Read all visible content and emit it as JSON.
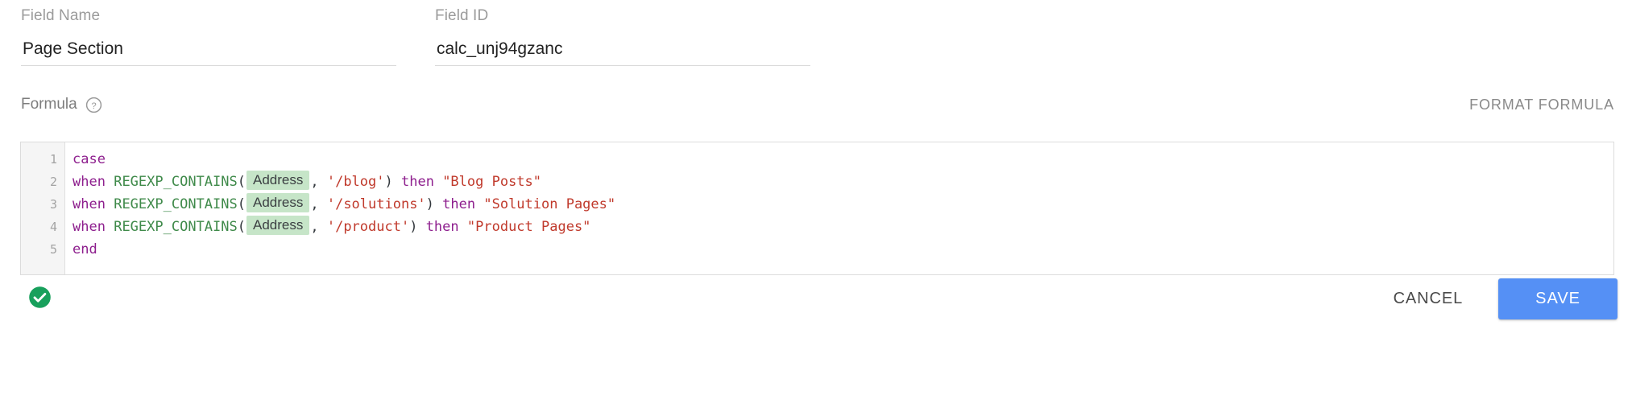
{
  "fields": [
    {
      "label": "Field Name",
      "value": "Page Section",
      "name": "field-name"
    },
    {
      "label": "Field ID",
      "value": "calc_unj94gzanc",
      "name": "field-id"
    }
  ],
  "formula": {
    "label": "Formula",
    "help_icon": "help-circle-icon",
    "format_button": "FORMAT FORMULA",
    "line_numbers": [
      "1",
      "2",
      "3",
      "4",
      "5"
    ],
    "lines": [
      {
        "n": "1",
        "tokens": [
          {
            "t": "keyword",
            "v": "case"
          }
        ]
      },
      {
        "n": "2",
        "tokens": [
          {
            "t": "keyword",
            "v": "when"
          },
          {
            "t": "plain",
            "v": " "
          },
          {
            "t": "function",
            "v": "REGEXP_CONTAINS"
          },
          {
            "t": "punct",
            "v": "("
          },
          {
            "t": "pill",
            "v": "Address"
          },
          {
            "t": "punct",
            "v": ", "
          },
          {
            "t": "string",
            "v": "'/blog'"
          },
          {
            "t": "punct",
            "v": ") "
          },
          {
            "t": "keyword",
            "v": "then"
          },
          {
            "t": "plain",
            "v": " "
          },
          {
            "t": "dstring",
            "v": "\"Blog Posts\""
          }
        ]
      },
      {
        "n": "3",
        "tokens": [
          {
            "t": "keyword",
            "v": "when"
          },
          {
            "t": "plain",
            "v": " "
          },
          {
            "t": "function",
            "v": "REGEXP_CONTAINS"
          },
          {
            "t": "punct",
            "v": "("
          },
          {
            "t": "pill",
            "v": "Address"
          },
          {
            "t": "punct",
            "v": ", "
          },
          {
            "t": "string",
            "v": "'/solutions'"
          },
          {
            "t": "punct",
            "v": ") "
          },
          {
            "t": "keyword",
            "v": "then"
          },
          {
            "t": "plain",
            "v": " "
          },
          {
            "t": "dstring",
            "v": "\"Solution Pages\""
          }
        ]
      },
      {
        "n": "4",
        "tokens": [
          {
            "t": "keyword",
            "v": "when"
          },
          {
            "t": "plain",
            "v": " "
          },
          {
            "t": "function",
            "v": "REGEXP_CONTAINS"
          },
          {
            "t": "punct",
            "v": "("
          },
          {
            "t": "pill",
            "v": "Address"
          },
          {
            "t": "punct",
            "v": ", "
          },
          {
            "t": "string",
            "v": "'/product'"
          },
          {
            "t": "punct",
            "v": ") "
          },
          {
            "t": "keyword",
            "v": "then"
          },
          {
            "t": "plain",
            "v": " "
          },
          {
            "t": "dstring",
            "v": "\"Product Pages\""
          }
        ]
      },
      {
        "n": "5",
        "tokens": [
          {
            "t": "keyword",
            "v": "end"
          }
        ]
      }
    ]
  },
  "footer": {
    "validation_icon": "check-circle-icon",
    "cancel_label": "CANCEL",
    "save_label": "SAVE"
  },
  "colors": {
    "keyword": "#8e1f8e",
    "function": "#3f8a4a",
    "string": "#c0392b",
    "pill_bg": "#c6e5c8",
    "save_blue": "#5590f5",
    "valid_green": "#18a05c",
    "label_gray": "#9b9b9b"
  }
}
